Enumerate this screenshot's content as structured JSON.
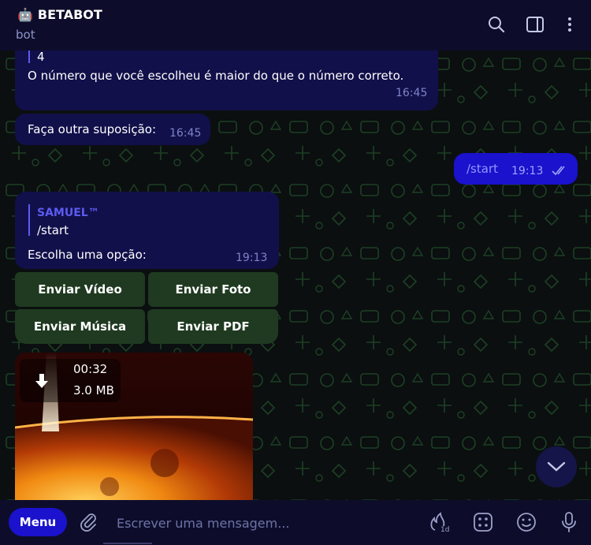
{
  "header": {
    "bot_icon": "🤖",
    "title": "BETABOT",
    "subtitle": "bot",
    "icons": [
      "search-icon",
      "sidebar-toggle-icon",
      "more-vertical-icon"
    ]
  },
  "messages": {
    "m1": {
      "quote_text": "4",
      "text": "O número que você escolheu é maior do que o número correto.",
      "time": "16:45"
    },
    "m2": {
      "text": "Faça outra suposição:",
      "time": "16:45"
    },
    "m3": {
      "text": "/start",
      "time": "19:13"
    },
    "m4": {
      "quote_author": "SAMUEL™",
      "quote_text": "/start",
      "text": "Escolha uma opção:",
      "time": "19:13"
    }
  },
  "keyboard": {
    "buttons": [
      "Enviar Vídeo",
      "Enviar Foto",
      "Enviar Música",
      "Enviar PDF"
    ]
  },
  "media": {
    "duration": "00:32",
    "size": "3.0 MB"
  },
  "composer": {
    "menu_label": "Menu",
    "placeholder": "Escrever uma mensagem...",
    "icons": [
      "attach-icon",
      "self-destruct-timer-icon",
      "commands-icon",
      "emoji-icon",
      "microphone-icon"
    ]
  },
  "colors": {
    "header_bg": "#0d0d2b",
    "bubble_in": "#12104a",
    "bubble_out": "#1a12cc",
    "keyboard_button": "#1f3a20",
    "time_text": "#7d83c9",
    "accent": "#5b5bf0"
  }
}
